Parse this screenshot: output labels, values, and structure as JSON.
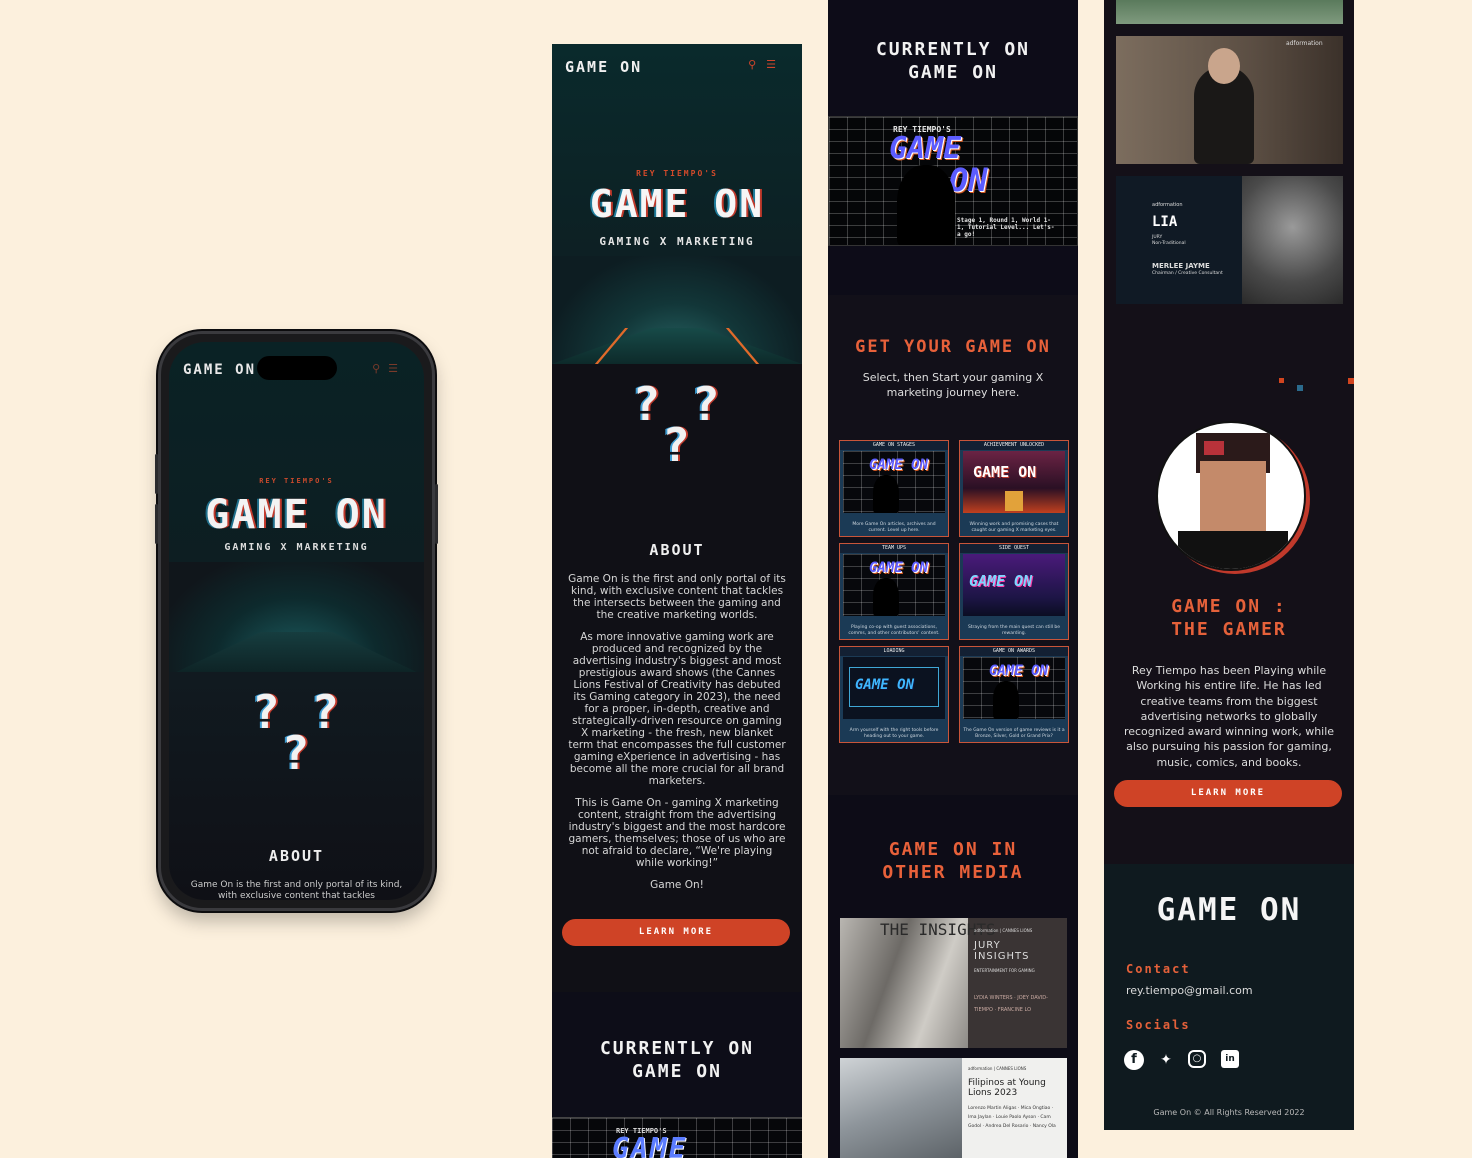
{
  "brand": {
    "logo": "GAME ON"
  },
  "header_icons": [
    "search-icon",
    "menu-icon"
  ],
  "hero": {
    "subtitle": "REY TIEMPO'S",
    "title": "GAME ON",
    "tagline": "GAMING X MARKETING"
  },
  "question_marks": "? ?\n?",
  "about": {
    "heading": "ABOUT",
    "paragraphs": [
      "Game On is the first and only portal of its kind, with exclusive content that tackles the intersects between the gaming and the creative marketing worlds.",
      "As more innovative gaming work are produced and recognized by the advertising industry's biggest and most prestigious award shows (the Cannes Lions Festival of Creativity has debuted its Gaming category in 2023), the need for a proper, in-depth, creative and strategically-driven resource on gaming X marketing - the fresh, new blanket term that encompasses the full customer gaming eXperience in advertising - has become all the more crucial for all brand marketers.",
      "This is Game On - gaming X marketing content, straight from the advertising industry's biggest and the most hardcore gamers, themselves; those of us who are not afraid to declare, “We're playing while working!”",
      "Game On!"
    ],
    "phone_preview": "Game On is the first and only portal of its kind, with exclusive content that tackles",
    "button": "LEARN MORE"
  },
  "currently_on": {
    "heading_line1": "CURRENTLY ON",
    "heading_line2": "GAME ON",
    "banner": {
      "subtitle": "REY TIEMPO'S",
      "title_line1": "GAME",
      "title_line2": "ON",
      "caption": "Stage 1, Round 1, World 1-1, Tutorial Level... Let's-a go!"
    }
  },
  "get_game": {
    "heading": "GET YOUR GAME ON",
    "description": "Select, then Start your gaming X marketing journey here.",
    "cards": [
      {
        "title": "GAME ON STAGES",
        "img_text": "GAME ON",
        "desc": "More Game On articles, archives and current. Level up here."
      },
      {
        "title": "ACHIEVEMENT UNLOCKED",
        "img_text": "GAME ON",
        "desc": "Winning work and promising cases that caught our gaming X marketing eyes."
      },
      {
        "title": "TEAM UPS",
        "img_text": "GAME ON",
        "desc": "Playing co-op with guest associations, comms, and other contributors' content."
      },
      {
        "title": "SIDE QUEST",
        "img_text": "GAME ON",
        "desc": "Straying from the main quest can still be rewarding."
      },
      {
        "title": "LOADING",
        "img_text": "GAME ON",
        "desc": "Arm yourself with the right tools before heading out to your game."
      },
      {
        "title": "GAME ON AWARDS",
        "img_text": "GAME ON",
        "desc": "The Game On version of game reviews is it a Bronze, Silver, Gold or Grand Prix?"
      }
    ]
  },
  "media": {
    "heading_line1": "GAME ON IN",
    "heading_line2": "OTHER MEDIA",
    "items": [
      {
        "org": "adformation | CANNES LIONS",
        "title": "JURY INSIGHTS",
        "sub": "ENTERTAINMENT FOR GAMING",
        "names": "LYDIA WINTERS · JOEY DAVID-TIEMPO · FRANCINE LO",
        "bg_text": "THE INSIGHTS"
      },
      {
        "org": "adformation | CANNES LIONS",
        "title": "Filipinos at Young Lions 2023",
        "names": "Lorenzo Martin Aligas · Mica Ongtiao · Ima Jaylan · Louie Paolo Ayson · Cam Godol · Andrea Del Rosario · Nancy Ola"
      },
      {
        "org": "adformation",
        "badge": "LIA",
        "label": "JURY",
        "label2": "Non-Traditional",
        "name": "MERLEE JAYME",
        "role": "Chairman / Creative Consultant"
      }
    ]
  },
  "gamer": {
    "heading_line1": "GAME ON :",
    "heading_line2": "THE GAMER",
    "description": "Rey Tiempo has been Playing while Working his entire life. He has led creative teams from the biggest advertising networks to globally recognized award winning work, while also pursuing his passion for gaming, music, comics, and books.",
    "button": "LEARN MORE"
  },
  "footer": {
    "logo": "GAME ON",
    "contact_label": "Contact",
    "email": "rey.tiempo@gmail.com",
    "socials_label": "Socials",
    "socials": [
      "facebook-icon",
      "twitter-icon",
      "instagram-icon",
      "linkedin-icon"
    ],
    "copyright": "Game On © All Rights Reserved 2022"
  },
  "colors": {
    "accent": "#cf4326",
    "heading_orange": "#e5613a",
    "page_bg": "#fcf0dd",
    "dark_bg": "#121019",
    "footer_bg": "#0f1a1f"
  }
}
